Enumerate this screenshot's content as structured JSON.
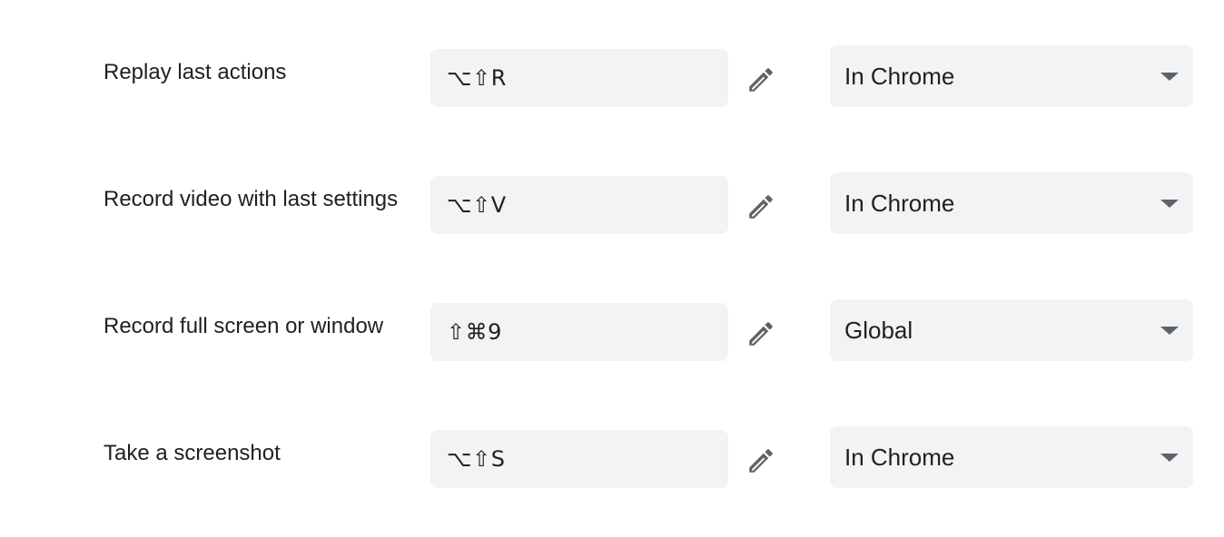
{
  "shortcuts": [
    {
      "label": "Replay last actions",
      "keys": "⌥⇧R",
      "scope": "In Chrome",
      "edit_icon": "pencil-icon",
      "dropdown_icon": "caret-down-icon"
    },
    {
      "label": "Record video with last settings",
      "keys": "⌥⇧V",
      "scope": "In Chrome",
      "edit_icon": "pencil-icon",
      "dropdown_icon": "caret-down-icon"
    },
    {
      "label": "Record full screen or window",
      "keys": "⇧⌘9",
      "scope": "Global",
      "edit_icon": "pencil-icon",
      "dropdown_icon": "caret-down-icon"
    },
    {
      "label": "Take a screenshot",
      "keys": "⌥⇧S",
      "scope": "In Chrome",
      "edit_icon": "pencil-icon",
      "dropdown_icon": "caret-down-icon"
    }
  ],
  "colors": {
    "field_background": "#f1f3f4",
    "text": "#202124",
    "icon": "#5f6368"
  }
}
